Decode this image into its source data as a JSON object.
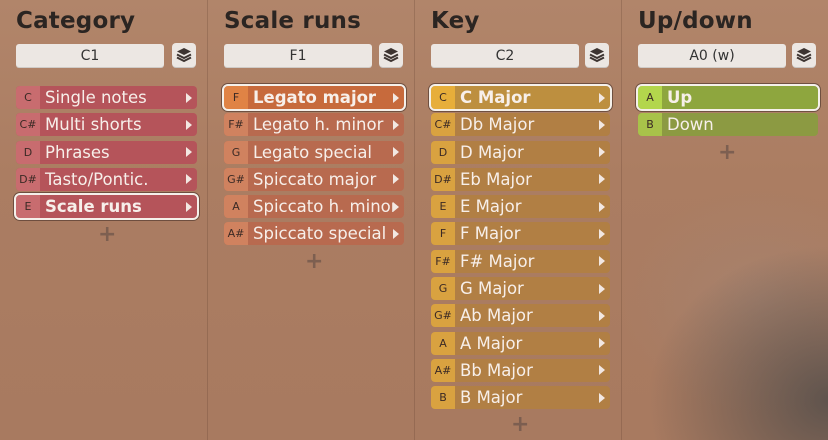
{
  "columns": [
    {
      "title": "Category",
      "selector": "C1",
      "items": [
        {
          "note": "C",
          "label": "Single notes"
        },
        {
          "note": "C#",
          "label": "Multi shorts"
        },
        {
          "note": "D",
          "label": "Phrases"
        },
        {
          "note": "D#",
          "label": "Tasto/Pontic."
        },
        {
          "note": "E",
          "label": "Scale runs",
          "selected": true
        }
      ]
    },
    {
      "title": "Scale runs",
      "selector": "F1",
      "items": [
        {
          "note": "F",
          "label": "Legato major",
          "selected": true
        },
        {
          "note": "F#",
          "label": "Legato h. minor"
        },
        {
          "note": "G",
          "label": "Legato special"
        },
        {
          "note": "G#",
          "label": "Spiccato major"
        },
        {
          "note": "A",
          "label": "Spiccato h. minor"
        },
        {
          "note": "A#",
          "label": "Spiccato special"
        }
      ]
    },
    {
      "title": "Key",
      "selector": "C2",
      "items": [
        {
          "note": "C",
          "label": "C Major",
          "selected": true
        },
        {
          "note": "C#",
          "label": "Db Major"
        },
        {
          "note": "D",
          "label": "D Major"
        },
        {
          "note": "D#",
          "label": "Eb Major"
        },
        {
          "note": "E",
          "label": "E Major"
        },
        {
          "note": "F",
          "label": "F Major"
        },
        {
          "note": "F#",
          "label": "F# Major"
        },
        {
          "note": "G",
          "label": "G Major"
        },
        {
          "note": "G#",
          "label": "Ab Major"
        },
        {
          "note": "A",
          "label": "A Major"
        },
        {
          "note": "A#",
          "label": "Bb Major"
        },
        {
          "note": "B",
          "label": "B Major"
        }
      ]
    },
    {
      "title": "Up/down",
      "selector": "A0 (w)",
      "items": [
        {
          "note": "A",
          "label": "Up",
          "selected": true
        },
        {
          "note": "B",
          "label": "Down"
        }
      ]
    }
  ],
  "add_symbol": "+",
  "icons": {
    "layers": "layers-icon",
    "arrow": "chevron-right-icon",
    "add": "plus-icon"
  }
}
